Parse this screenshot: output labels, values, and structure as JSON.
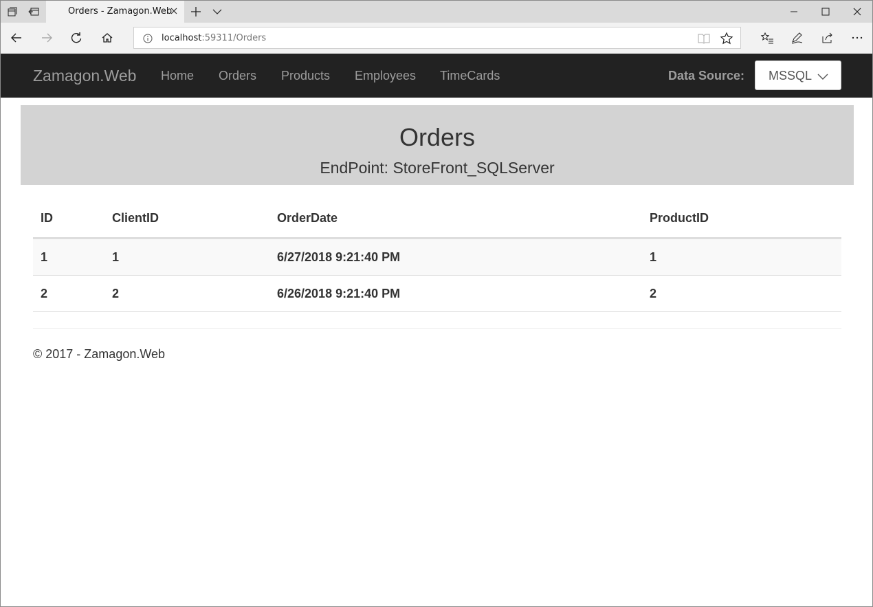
{
  "browser": {
    "tab_title": "Orders - Zamagon.Web",
    "url_host": "localhost",
    "url_path": ":59311/Orders"
  },
  "site": {
    "brand": "Zamagon.Web",
    "nav": [
      {
        "label": "Home"
      },
      {
        "label": "Orders"
      },
      {
        "label": "Products"
      },
      {
        "label": "Employees"
      },
      {
        "label": "TimeCards"
      }
    ],
    "data_source_label": "Data Source:",
    "data_source_value": "MSSQL"
  },
  "page": {
    "title": "Orders",
    "subtitle": "EndPoint: StoreFront_SQLServer"
  },
  "table": {
    "headers": [
      "ID",
      "ClientID",
      "OrderDate",
      "ProductID"
    ],
    "rows": [
      [
        "1",
        "1",
        "6/27/2018 9:21:40 PM",
        "1"
      ],
      [
        "2",
        "2",
        "6/26/2018 9:21:40 PM",
        "2"
      ]
    ]
  },
  "footer": {
    "text": "© 2017 - Zamagon.Web"
  }
}
